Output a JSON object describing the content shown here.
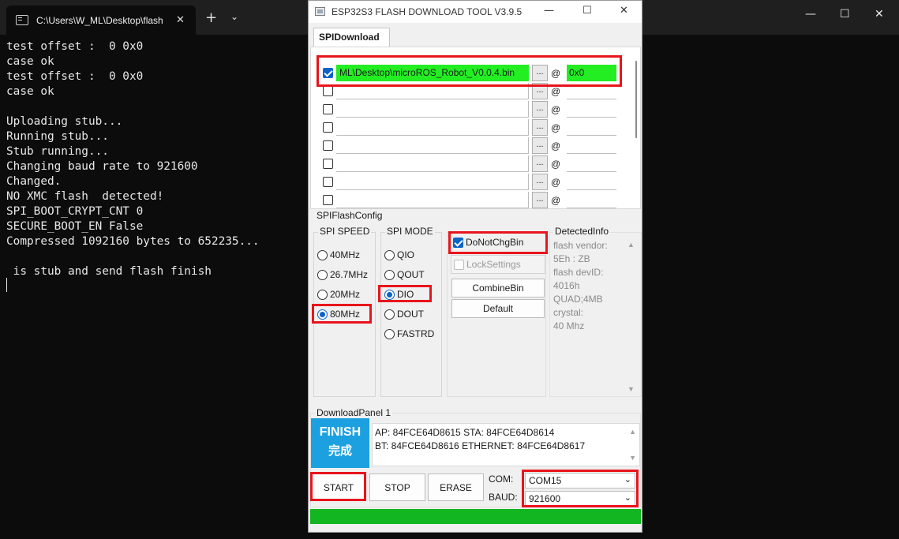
{
  "terminal": {
    "tab_title": "C:\\Users\\W_ML\\Desktop\\flash",
    "tab_close": "✕",
    "new_tab": "+",
    "tab_dropdown": "⌄",
    "win_min": "—",
    "win_max": "☐",
    "win_close": "✕",
    "lines": [
      "test offset :  0 0x0",
      "case ok",
      "test offset :  0 0x0",
      "case ok",
      "",
      "Uploading stub...",
      "Running stub...",
      "Stub running...",
      "Changing baud rate to 921600",
      "Changed.",
      "NO XMC flash  detected!",
      "SPI_BOOT_CRYPT_CNT 0",
      "SECURE_BOOT_EN False",
      "Compressed 1092160 bytes to 652235...",
      "",
      " is stub and send flash finish"
    ]
  },
  "esp_tool": {
    "title": "ESP32S3 FLASH DOWNLOAD TOOL V3.9.5",
    "win_min": "—",
    "win_max": "☐",
    "win_close": "✕",
    "tab_label": "SPIDownload",
    "files": [
      {
        "checked": true,
        "path": "ML\\Desktop\\microROS_Robot_V0.0.4.bin",
        "browse": "...",
        "at": "@",
        "offset": "0x0"
      },
      {
        "checked": false,
        "path": "",
        "browse": "...",
        "at": "@",
        "offset": ""
      },
      {
        "checked": false,
        "path": "",
        "browse": "...",
        "at": "@",
        "offset": ""
      },
      {
        "checked": false,
        "path": "",
        "browse": "...",
        "at": "@",
        "offset": ""
      },
      {
        "checked": false,
        "path": "",
        "browse": "...",
        "at": "@",
        "offset": ""
      },
      {
        "checked": false,
        "path": "",
        "browse": "...",
        "at": "@",
        "offset": ""
      },
      {
        "checked": false,
        "path": "",
        "browse": "...",
        "at": "@",
        "offset": ""
      },
      {
        "checked": false,
        "path": "",
        "browse": "...",
        "at": "@",
        "offset": ""
      }
    ],
    "spi_flash_config": {
      "title": "SPIFlashConfig",
      "spi_speed": {
        "title": "SPI SPEED",
        "options": [
          "40MHz",
          "26.7MHz",
          "20MHz",
          "80MHz"
        ],
        "selected": "80MHz"
      },
      "spi_mode": {
        "title": "SPI MODE",
        "options": [
          "QIO",
          "QOUT",
          "DIO",
          "DOUT",
          "FASTRD"
        ],
        "selected": "DIO"
      },
      "do_not_chg_bin": {
        "label": "DoNotChgBin",
        "checked": true
      },
      "lock_settings": {
        "label": "LockSettings",
        "checked": false
      },
      "combine_bin_label": "CombineBin",
      "default_label": "Default",
      "detected_info": {
        "title": "DetectedInfo",
        "lines": [
          "flash vendor:",
          "5Eh : ZB",
          "flash devID:",
          "4016h",
          "QUAD;4MB",
          "crystal:",
          "40 Mhz"
        ],
        "scroll_up": "▲",
        "scroll_down": "▼"
      }
    },
    "download_panel": {
      "title": "DownloadPanel 1",
      "status_en": "FINISH",
      "status_cn": "完成",
      "status_color": "#1da0e0",
      "mac_lines": [
        "AP:  84FCE64D8615  STA:  84FCE64D8614",
        "BT:  84FCE64D8616  ETHERNET:  84FCE64D8617"
      ],
      "scroll_up": "▲",
      "scroll_down": "▼",
      "start_label": "START",
      "stop_label": "STOP",
      "erase_label": "ERASE",
      "com_label": "COM:",
      "com_value": "COM15",
      "baud_label": "BAUD:",
      "baud_value": "921600",
      "caret": "⌄",
      "progress": 1.0,
      "progress_color": "#11b620"
    },
    "highlight_color": "#e8141c"
  }
}
